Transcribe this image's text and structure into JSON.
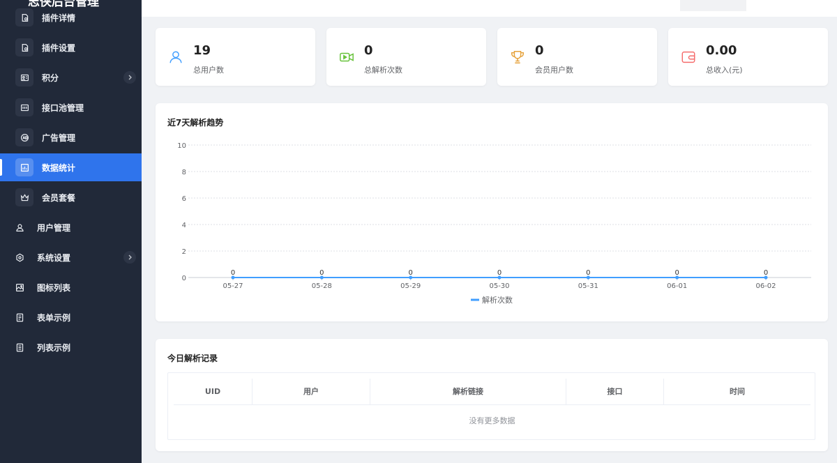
{
  "app": {
    "title": "志侠后台管理"
  },
  "sidebar": {
    "items": [
      {
        "label": "插件详情",
        "icon": "plugin-file-icon"
      },
      {
        "label": "插件设置",
        "icon": "plugin-settings-icon"
      },
      {
        "label": "积分",
        "icon": "points-icon"
      },
      {
        "label": "接口池管理",
        "icon": "api-pool-icon"
      },
      {
        "label": "广告管理",
        "icon": "ad-icon"
      },
      {
        "label": "数据统计",
        "icon": "chart-icon",
        "active": true
      },
      {
        "label": "会员套餐",
        "icon": "crown-icon"
      },
      {
        "label": "用户管理",
        "icon": "user-icon"
      },
      {
        "label": "系统设置",
        "icon": "gear-icon"
      },
      {
        "label": "图标列表",
        "icon": "image-icon"
      },
      {
        "label": "表单示例",
        "icon": "form-icon"
      },
      {
        "label": "列表示例",
        "icon": "list-icon"
      }
    ]
  },
  "stats": [
    {
      "value": "19",
      "label": "总用户数",
      "icon": "user-icon",
      "color": "#409eff"
    },
    {
      "value": "0",
      "label": "总解析次数",
      "icon": "video-icon",
      "color": "#67c23a"
    },
    {
      "value": "0",
      "label": "会员用户数",
      "icon": "trophy-icon",
      "color": "#e6a23c"
    },
    {
      "value": "0.00",
      "label": "总收入(元)",
      "icon": "wallet-icon",
      "color": "#f56c6c"
    }
  ],
  "chart_section": {
    "title": "近7天解析趋势"
  },
  "chart_data": {
    "type": "line",
    "categories": [
      "05-27",
      "05-28",
      "05-29",
      "05-30",
      "05-31",
      "06-01",
      "06-02"
    ],
    "series": [
      {
        "name": "解析次数",
        "values": [
          0,
          0,
          0,
          0,
          0,
          0,
          0
        ],
        "color": "#409eff"
      }
    ],
    "ylim": [
      0,
      10
    ],
    "yticks": [
      0,
      2,
      4,
      6,
      8,
      10
    ],
    "grid": true,
    "legend": "bottom"
  },
  "records": {
    "title": "今日解析记录",
    "columns": [
      "UID",
      "用户",
      "解析链接",
      "接口",
      "时间"
    ],
    "empty_text": "没有更多数据"
  }
}
